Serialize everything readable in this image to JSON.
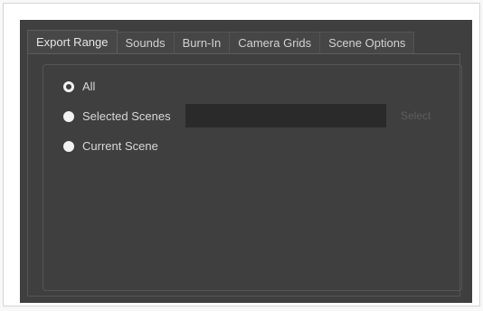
{
  "tabs": [
    {
      "label": "Export Range",
      "active": true
    },
    {
      "label": "Sounds",
      "active": false
    },
    {
      "label": "Burn-In",
      "active": false
    },
    {
      "label": "Camera Grids",
      "active": false
    },
    {
      "label": "Scene Options",
      "active": false
    }
  ],
  "export_range": {
    "options": [
      {
        "label": "All",
        "selected": true
      },
      {
        "label": "Selected Scenes",
        "selected": false
      },
      {
        "label": "Current Scene",
        "selected": false
      }
    ],
    "scene_field_value": "",
    "select_button_label": "Select"
  },
  "colors": {
    "panel_bg": "#3f3f3f",
    "input_bg": "#2a2a2a",
    "text": "#d8d8d8",
    "disabled_text": "#5e5e5e"
  }
}
